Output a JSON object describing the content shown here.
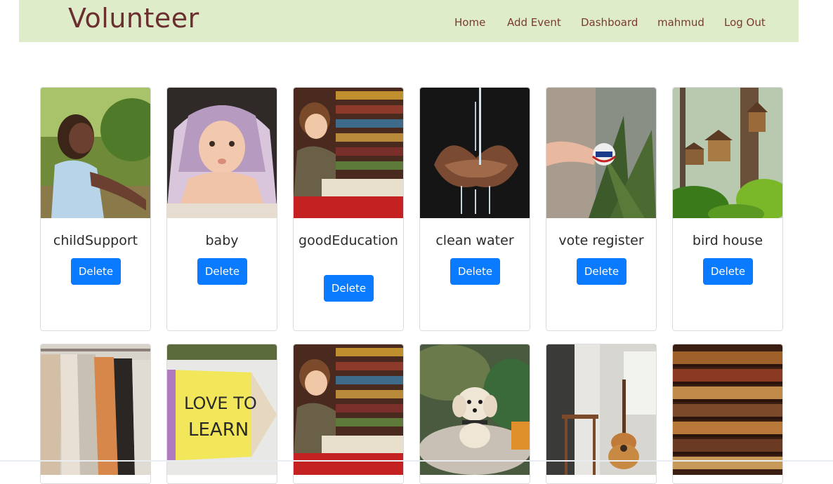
{
  "header": {
    "brand": "Volunteer",
    "nav": [
      "Home",
      "Add Event",
      "Dashboard",
      "mahmud",
      "Log Out"
    ]
  },
  "delete_label": "Delete",
  "events": [
    {
      "title": "childSupport",
      "image": "child-outdoors-photo"
    },
    {
      "title": "baby",
      "image": "baby-under-blanket-photo"
    },
    {
      "title": "goodEducation",
      "image": "boy-reading-library-photo"
    },
    {
      "title": "clean water",
      "image": "hands-water-photo"
    },
    {
      "title": "vote register",
      "image": "voted-sticker-photo"
    },
    {
      "title": "bird house",
      "image": "birdhouse-forest-photo"
    },
    {
      "title": "",
      "image": "clothes-rack-photo"
    },
    {
      "title": "",
      "image": "love-to-learn-pencil-photo"
    },
    {
      "title": "",
      "image": "boy-reading-library-photo"
    },
    {
      "title": "",
      "image": "white-puppy-photo"
    },
    {
      "title": "",
      "image": "guitar-room-photo"
    },
    {
      "title": "",
      "image": "bookshelf-photo"
    }
  ],
  "colors": {
    "navbar_bg": "#dfecca",
    "brand": "#6b2f2f",
    "nav_link": "#7a3b2e",
    "button": "#0a7bff"
  }
}
